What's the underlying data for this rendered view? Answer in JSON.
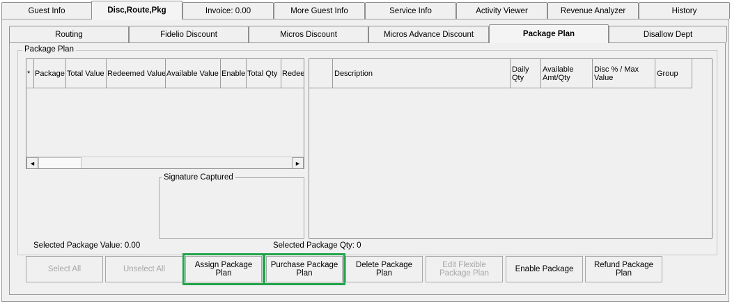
{
  "top_tabs": [
    {
      "label": "Guest Info",
      "active": false
    },
    {
      "label": "Disc,Route,Pkg",
      "active": true
    },
    {
      "label": "Invoice: 0.00",
      "active": false
    },
    {
      "label": "More Guest Info",
      "active": false
    },
    {
      "label": "Service Info",
      "active": false
    },
    {
      "label": "Activity Viewer",
      "active": false
    },
    {
      "label": "Revenue Analyzer",
      "active": false
    },
    {
      "label": "History",
      "active": false
    }
  ],
  "sub_tabs": [
    {
      "label": "Routing",
      "active": false
    },
    {
      "label": "Fidelio Discount",
      "active": false
    },
    {
      "label": "Micros Discount",
      "active": false
    },
    {
      "label": "Micros Advance Discount",
      "active": false
    },
    {
      "label": "Package Plan",
      "active": true
    },
    {
      "label": "Disallow Dept",
      "active": false
    }
  ],
  "package_plan": {
    "group_title": "Package Plan",
    "left_grid_columns": [
      "*",
      "Package",
      "Total Value",
      "Redeemed Value",
      "Available Value",
      "Enable",
      "Total Qty",
      "Redee"
    ],
    "right_grid_columns": [
      "",
      "Description",
      "Daily Qty",
      "Available Amt/Qty",
      "Disc % / Max Value",
      "Group"
    ],
    "signature_title": "Signature Captured",
    "selected_value": "Selected Package Value: 0.00",
    "selected_qty": "Selected Package Qty: 0"
  },
  "buttons": [
    {
      "label": "Select All",
      "enabled": false,
      "highlighted": false
    },
    {
      "label": "Unselect All",
      "enabled": false,
      "highlighted": false
    },
    {
      "label": "Assign Package Plan",
      "enabled": true,
      "highlighted": true
    },
    {
      "label": "Purchase Package Plan",
      "enabled": true,
      "highlighted": true
    },
    {
      "label": "Delete Package Plan",
      "enabled": true,
      "highlighted": false
    },
    {
      "label": "Edit Flexible Package Plan",
      "enabled": false,
      "highlighted": false
    },
    {
      "label": "Enable Package",
      "enabled": true,
      "highlighted": false
    },
    {
      "label": "Refund Package Plan",
      "enabled": true,
      "highlighted": false
    }
  ],
  "scroll_arrows": {
    "left": "◄",
    "right": "►"
  },
  "colors": {
    "highlight": "#22a34a",
    "panel": "#f0f0f0",
    "border": "#9a9a9a"
  }
}
